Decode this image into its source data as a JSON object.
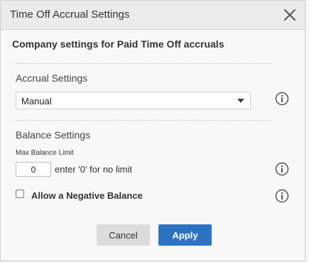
{
  "dialog": {
    "title": "Time Off Accrual Settings",
    "subtitle": "Company settings for Paid Time Off accruals"
  },
  "accrual": {
    "section_label": "Accrual Settings",
    "selected": "Manual"
  },
  "balance": {
    "section_label": "Balance Settings",
    "max_label": "Max Balance Limit",
    "max_value": "0",
    "hint": "enter '0' for no limit",
    "negative_label": "Allow a Negative Balance"
  },
  "buttons": {
    "cancel": "Cancel",
    "apply": "Apply"
  },
  "colors": {
    "accent": "#2d73c3",
    "title_bar": "#ebebeb"
  },
  "icons": [
    "close-icon",
    "info-icon"
  ]
}
